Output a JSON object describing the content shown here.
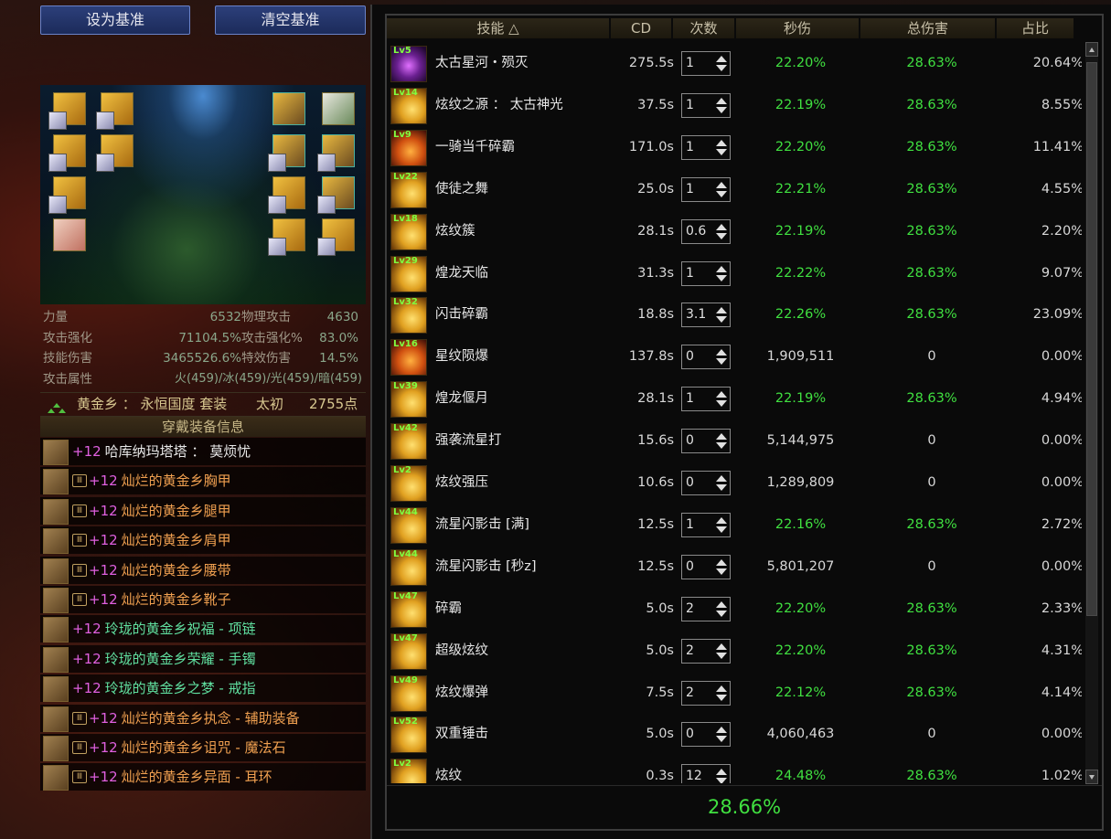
{
  "buttons": {
    "set_baseline": "设为基准",
    "clear_baseline": "清空基准"
  },
  "stats": [
    {
      "l1": "力量",
      "v1": "6532",
      "l2": "物理攻击",
      "v2": "4630"
    },
    {
      "l1": "攻击强化",
      "v1": "71104.5%",
      "l2": "攻击强化%",
      "v2": "83.0%"
    },
    {
      "l1": "技能伤害",
      "v1": "3465526.6%",
      "l2": "特效伤害",
      "v2": "14.5%"
    }
  ],
  "attack_attr": {
    "label": "攻击属性",
    "value": "火(459)/冰(459)/光(459)/暗(459)"
  },
  "set_info": {
    "name": "黄金乡 ： 永恒国度 套装",
    "tier": "太初",
    "points": "2755点"
  },
  "equip_header": "穿戴装备信息",
  "equipment": [
    {
      "plus": "+12",
      "name": "哈库纳玛塔塔 ： 莫烦忧",
      "color": "white",
      "mark": false,
      "icon": "weapon-icon"
    },
    {
      "plus": "+12",
      "name": "灿烂的黄金乡胸甲",
      "color": "gold",
      "mark": true,
      "icon": "chest-armor-icon"
    },
    {
      "plus": "+12",
      "name": "灿烂的黄金乡腿甲",
      "color": "gold",
      "mark": true,
      "icon": "leg-armor-icon"
    },
    {
      "plus": "+12",
      "name": "灿烂的黄金乡肩甲",
      "color": "gold",
      "mark": true,
      "icon": "shoulder-armor-icon"
    },
    {
      "plus": "+12",
      "name": "灿烂的黄金乡腰带",
      "color": "gold",
      "mark": true,
      "icon": "belt-icon"
    },
    {
      "plus": "+12",
      "name": "灿烂的黄金乡靴子",
      "color": "gold",
      "mark": true,
      "icon": "boots-icon"
    },
    {
      "plus": "+12",
      "name": "玲珑的黄金乡祝福 - 项链",
      "color": "green",
      "mark": false,
      "icon": "necklace-icon"
    },
    {
      "plus": "+12",
      "name": "玲珑的黄金乡荣耀 - 手镯",
      "color": "green",
      "mark": false,
      "icon": "bracelet-icon"
    },
    {
      "plus": "+12",
      "name": "玲珑的黄金乡之梦 - 戒指",
      "color": "green",
      "mark": false,
      "icon": "ring-icon"
    },
    {
      "plus": "+12",
      "name": "灿烂的黄金乡执念 - 辅助装备",
      "color": "gold",
      "mark": true,
      "icon": "support-equip-icon"
    },
    {
      "plus": "+12",
      "name": "灿烂的黄金乡诅咒 - 魔法石",
      "color": "gold",
      "mark": true,
      "icon": "magic-stone-icon"
    },
    {
      "plus": "+12",
      "name": "灿烂的黄金乡异面 - 耳环",
      "color": "gold",
      "mark": true,
      "icon": "earring-icon"
    }
  ],
  "mark_label": "Ⅲ",
  "table": {
    "headers": [
      "技能 △",
      "CD",
      "次数",
      "秒伤",
      "总伤害",
      "占比"
    ],
    "rows": [
      {
        "lv": "Lv5",
        "name": "太古星河・殒灭",
        "cd": "275.5s",
        "count": "1",
        "dps": "22.20%",
        "total": "28.63%",
        "ratio": "20.64%",
        "style": "purple"
      },
      {
        "lv": "Lv14",
        "name": "炫纹之源 ： 太古神光",
        "cd": "37.5s",
        "count": "1",
        "dps": "22.19%",
        "total": "28.63%",
        "ratio": "8.55%",
        "style": "gold"
      },
      {
        "lv": "Lv9",
        "name": "一骑当千碎霸",
        "cd": "171.0s",
        "count": "1",
        "dps": "22.20%",
        "total": "28.63%",
        "ratio": "11.41%",
        "style": "fire"
      },
      {
        "lv": "Lv22",
        "name": "使徒之舞",
        "cd": "25.0s",
        "count": "1",
        "dps": "22.21%",
        "total": "28.63%",
        "ratio": "4.55%",
        "style": "gold"
      },
      {
        "lv": "Lv18",
        "name": "炫纹簇",
        "cd": "28.1s",
        "count": "0.6",
        "dps": "22.19%",
        "total": "28.63%",
        "ratio": "2.20%",
        "style": "gold"
      },
      {
        "lv": "Lv29",
        "name": "煌龙天临",
        "cd": "31.3s",
        "count": "1",
        "dps": "22.22%",
        "total": "28.63%",
        "ratio": "9.07%",
        "style": "gold"
      },
      {
        "lv": "Lv32",
        "name": "闪击碎霸",
        "cd": "18.8s",
        "count": "3.1",
        "dps": "22.26%",
        "total": "28.63%",
        "ratio": "23.09%",
        "style": "gold"
      },
      {
        "lv": "Lv16",
        "name": "星纹陨爆",
        "cd": "137.8s",
        "count": "0",
        "dps": "1,909,511",
        "total": "0",
        "ratio": "0.00%",
        "style": "fire"
      },
      {
        "lv": "Lv39",
        "name": "煌龙偃月",
        "cd": "28.1s",
        "count": "1",
        "dps": "22.19%",
        "total": "28.63%",
        "ratio": "4.94%",
        "style": "gold"
      },
      {
        "lv": "Lv42",
        "name": "强袭流星打",
        "cd": "15.6s",
        "count": "0",
        "dps": "5,144,975",
        "total": "0",
        "ratio": "0.00%",
        "style": "gold"
      },
      {
        "lv": "Lv2",
        "name": "炫纹强压",
        "cd": "10.6s",
        "count": "0",
        "dps": "1,289,809",
        "total": "0",
        "ratio": "0.00%",
        "style": "gold"
      },
      {
        "lv": "Lv44",
        "name": "流星闪影击 [满]",
        "cd": "12.5s",
        "count": "1",
        "dps": "22.16%",
        "total": "28.63%",
        "ratio": "2.72%",
        "style": "gold"
      },
      {
        "lv": "Lv44",
        "name": "流星闪影击 [秒z]",
        "cd": "12.5s",
        "count": "0",
        "dps": "5,801,207",
        "total": "0",
        "ratio": "0.00%",
        "style": "gold"
      },
      {
        "lv": "Lv47",
        "name": "碎霸",
        "cd": "5.0s",
        "count": "2",
        "dps": "22.20%",
        "total": "28.63%",
        "ratio": "2.33%",
        "style": "gold"
      },
      {
        "lv": "Lv47",
        "name": "超级炫纹",
        "cd": "5.0s",
        "count": "2",
        "dps": "22.20%",
        "total": "28.63%",
        "ratio": "4.31%",
        "style": "gold"
      },
      {
        "lv": "Lv49",
        "name": "炫纹爆弹",
        "cd": "7.5s",
        "count": "2",
        "dps": "22.12%",
        "total": "28.63%",
        "ratio": "4.14%",
        "style": "gold"
      },
      {
        "lv": "Lv52",
        "name": "双重锤击",
        "cd": "5.0s",
        "count": "0",
        "dps": "4,060,463",
        "total": "0",
        "ratio": "0.00%",
        "style": "gold"
      },
      {
        "lv": "Lv2",
        "name": "炫纹",
        "cd": "0.3s",
        "count": "12",
        "dps": "24.48%",
        "total": "28.63%",
        "ratio": "1.02%",
        "style": "gold"
      }
    ],
    "summary": "28.66%"
  },
  "colors": {
    "accent_green": "#40e040",
    "gold_text": "#f0a050",
    "green_text": "#60e0a0",
    "enhance_plus": "#e060e0"
  }
}
